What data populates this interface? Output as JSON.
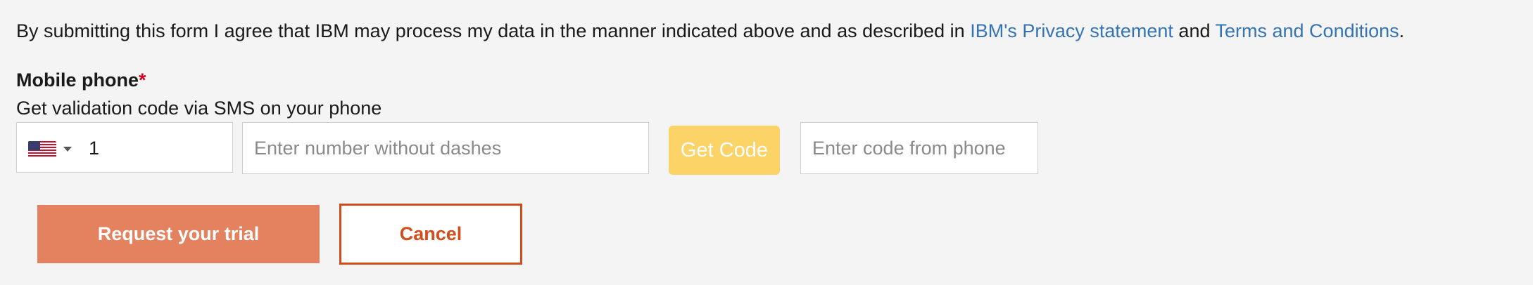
{
  "consent": {
    "text_before": "By submitting this form I agree that IBM may process my data in the manner indicated above and as described in ",
    "privacy_link": "IBM's Privacy statement",
    "text_between": " and ",
    "terms_link": "Terms and Conditions",
    "text_after": "."
  },
  "mobile_phone": {
    "label": "Mobile phone",
    "required_marker": "*",
    "hint": "Get validation code via SMS on your phone",
    "country_flag": "us-flag-icon",
    "dial_code": "1",
    "number_placeholder": "Enter number without dashes",
    "get_code_label": "Get Code",
    "code_placeholder": "Enter code from phone"
  },
  "actions": {
    "submit_label": "Request your trial",
    "cancel_label": "Cancel"
  },
  "colors": {
    "background": "#f4f4f4",
    "link": "#3574b3",
    "required": "#d0021b",
    "get_code_bg": "#fcd366",
    "primary_bg": "#e4825f",
    "cancel_border": "#d24d1e"
  }
}
